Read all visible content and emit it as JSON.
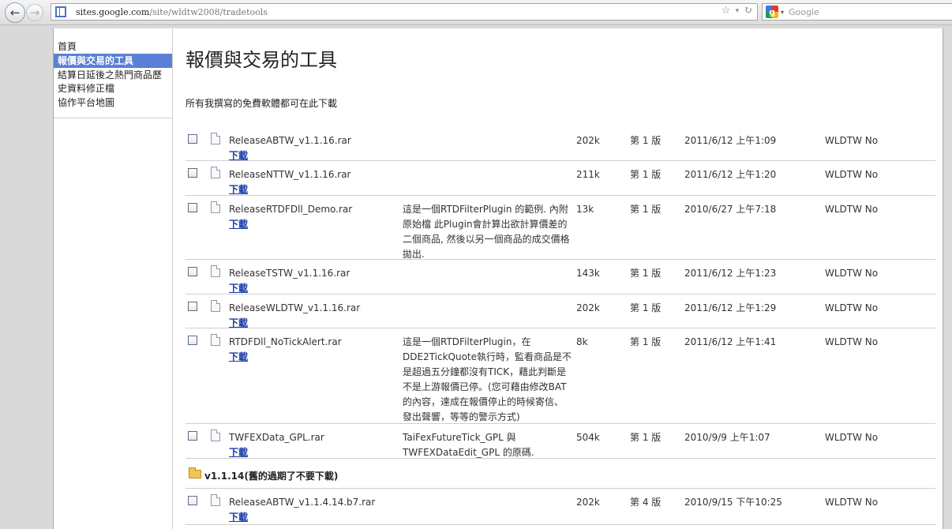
{
  "browser": {
    "url_host": "sites.google.com",
    "url_path": "/site/wldtw2008/tradetools",
    "search_placeholder": "Google"
  },
  "sidebar": {
    "items": [
      {
        "label": "首頁"
      },
      {
        "label": "報價與交易的工具",
        "active": true
      },
      {
        "label": "結算日延後之熱門商品歷史資料修正檔"
      },
      {
        "label": "協作平台地圖"
      }
    ]
  },
  "main": {
    "title": "報價與交易的工具",
    "description": "所有我撰寫的免費軟體都可在此下載",
    "download_label": "下載",
    "files": [
      {
        "name": "ReleaseABTW_v1.1.16.rar",
        "desc": "",
        "size": "202k",
        "version": "第 1 版",
        "date": "2011/6/12 上午1:09",
        "user": "WLDTW No"
      },
      {
        "name": "ReleaseNTTW_v1.1.16.rar",
        "desc": "",
        "size": "211k",
        "version": "第 1 版",
        "date": "2011/6/12 上午1:20",
        "user": "WLDTW No"
      },
      {
        "name": "ReleaseRTDFDll_Demo.rar",
        "desc": "這是一個RTDFilterPlugin 的範例. 內附原始檔 此Plugin會計算出欲計算價差的二個商品, 然後以另一個商品的成交價格拋出.",
        "size": "13k",
        "version": "第 1 版",
        "date": "2010/6/27 上午7:18",
        "user": "WLDTW No"
      },
      {
        "name": "ReleaseTSTW_v1.1.16.rar",
        "desc": "",
        "size": "143k",
        "version": "第 1 版",
        "date": "2011/6/12 上午1:23",
        "user": "WLDTW No"
      },
      {
        "name": "ReleaseWLDTW_v1.1.16.rar",
        "desc": "",
        "size": "202k",
        "version": "第 1 版",
        "date": "2011/6/12 上午1:29",
        "user": "WLDTW No"
      },
      {
        "name": "RTDFDll_NoTickAlert.rar",
        "desc": "這是一個RTDFilterPlugin，在DDE2TickQuote執行時，監看商品是不是超過五分鐘都沒有TICK，藉此判斷是不是上游報價已停。(您可藉由修改BAT的內容，達成在報價停止的時候寄信、發出聲響，等等的警示方式)",
        "size": "8k",
        "version": "第 1 版",
        "date": "2011/6/12 上午1:41",
        "user": "WLDTW No"
      },
      {
        "name": "TWFEXData_GPL.rar",
        "desc": "TaiFexFutureTick_GPL 與 TWFEXDataEdit_GPL 的原碼.",
        "size": "504k",
        "version": "第 1 版",
        "date": "2010/9/9 上午1:07",
        "user": "WLDTW No"
      }
    ],
    "folder": {
      "label": "v1.1.14(舊的過期了不要下載)"
    },
    "folder_files": [
      {
        "name": "ReleaseABTW_v1.1.4.14.b7.rar",
        "desc": "",
        "size": "202k",
        "version": "第 4 版",
        "date": "2010/9/15 下午10:25",
        "user": "WLDTW No"
      }
    ]
  }
}
